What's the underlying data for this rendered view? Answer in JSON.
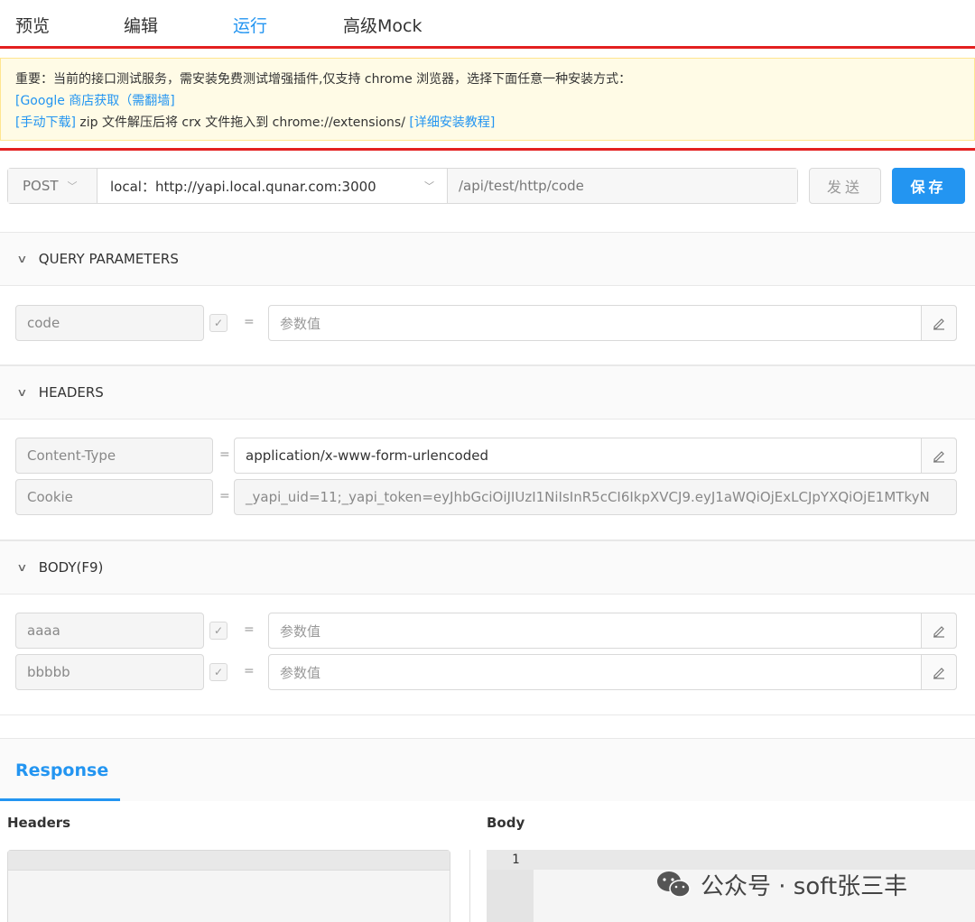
{
  "tabs": [
    {
      "label": "预览"
    },
    {
      "label": "编辑"
    },
    {
      "label": "运行"
    },
    {
      "label": "高级Mock"
    }
  ],
  "notice": {
    "line1": "重要：当前的接口测试服务，需安装免费测试增强插件,仅支持 chrome 浏览器，选择下面任意一种安装方式：",
    "google_link": "[Google 商店获取（需翻墙]",
    "manual_link": "[手动下载]",
    "manual_text": " zip 文件解压后将 crx 文件拖入到 chrome://extensions/ ",
    "tutorial_link": "[详细安装教程]"
  },
  "request": {
    "method": "POST",
    "env": "local：http://yapi.local.qunar.com:3000",
    "path": "/api/test/http/code",
    "send_label": "发送",
    "save_label": "保存"
  },
  "query": {
    "title": "QUERY PARAMETERS",
    "params": [
      {
        "name": "code",
        "placeholder": "参数值"
      }
    ]
  },
  "headers": {
    "title": "HEADERS",
    "items": [
      {
        "name": "Content-Type",
        "value": "application/x-www-form-urlencoded"
      },
      {
        "name": "Cookie",
        "value": "_yapi_uid=11;_yapi_token=eyJhbGciOiJIUzI1NiIsInR5cCI6IkpXVCJ9.eyJ1aWQiOjExLCJpYXQiOjE1MTkyN"
      }
    ]
  },
  "body": {
    "title": "BODY(F9)",
    "params": [
      {
        "name": "aaaa",
        "placeholder": "参数值"
      },
      {
        "name": "bbbbb",
        "placeholder": "参数值"
      }
    ]
  },
  "response": {
    "tab": "Response",
    "headers_label": "Headers",
    "body_label": "Body",
    "line_number": "1"
  },
  "watermark": "公众号 · soft张三丰",
  "colors": {
    "accent": "#2395f1",
    "highlight_border": "#e32020",
    "notice_bg": "#fffbe6"
  }
}
